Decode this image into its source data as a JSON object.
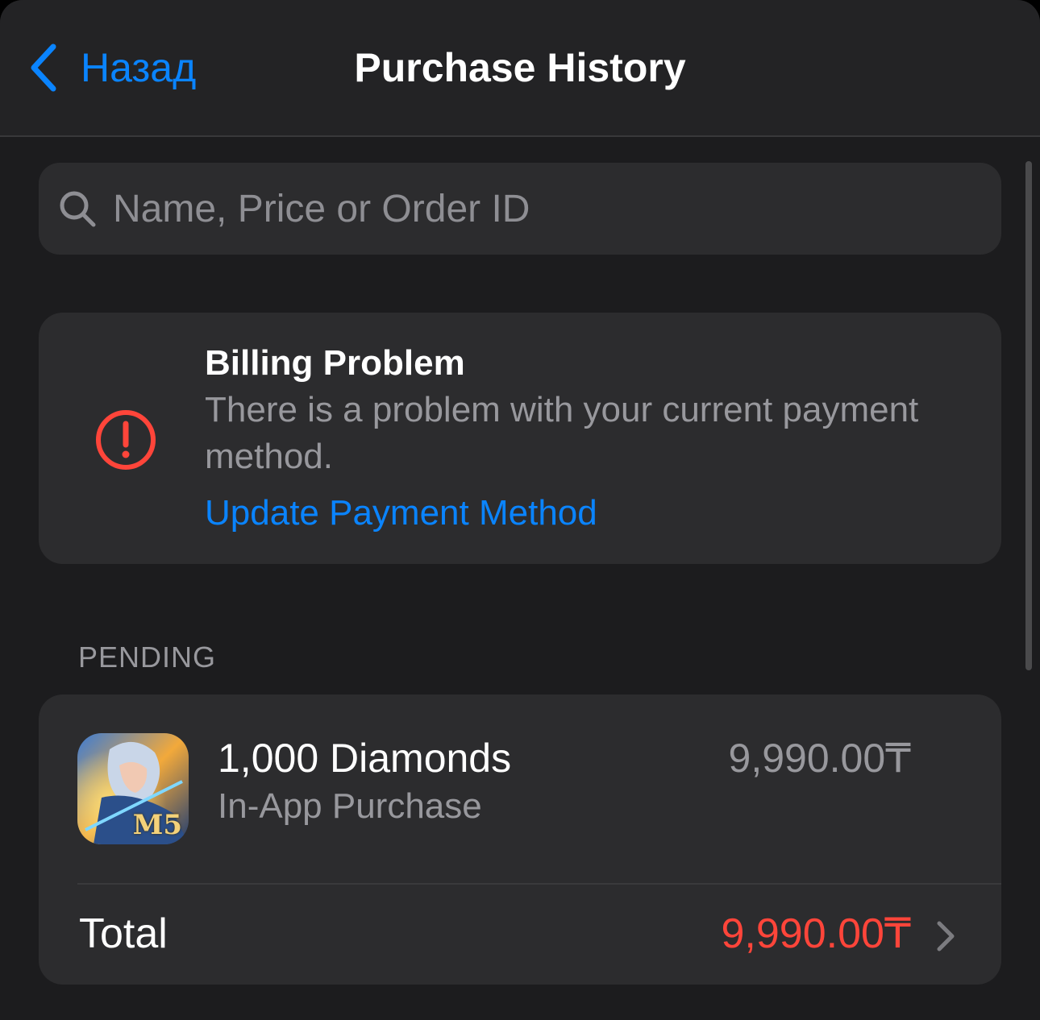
{
  "navbar": {
    "back_label": "Назад",
    "title": "Purchase History"
  },
  "search": {
    "placeholder": "Name, Price or Order ID",
    "value": ""
  },
  "billing": {
    "title": "Billing Problem",
    "message": "There is a problem with your current payment method.",
    "link_label": "Update Payment Method",
    "icon": "exclamation-circle-icon"
  },
  "pending": {
    "header": "PENDING",
    "items": [
      {
        "title": "1,000 Diamonds",
        "subtitle": "In-App Purchase",
        "price": "9,990.00₸",
        "icon_badge": "M5"
      }
    ],
    "total_label": "Total",
    "total_value": "9,990.00₸"
  },
  "colors": {
    "accent": "#0a84ff",
    "alert": "#ff453a",
    "background": "#1c1c1e",
    "card": "#2c2c2e"
  }
}
